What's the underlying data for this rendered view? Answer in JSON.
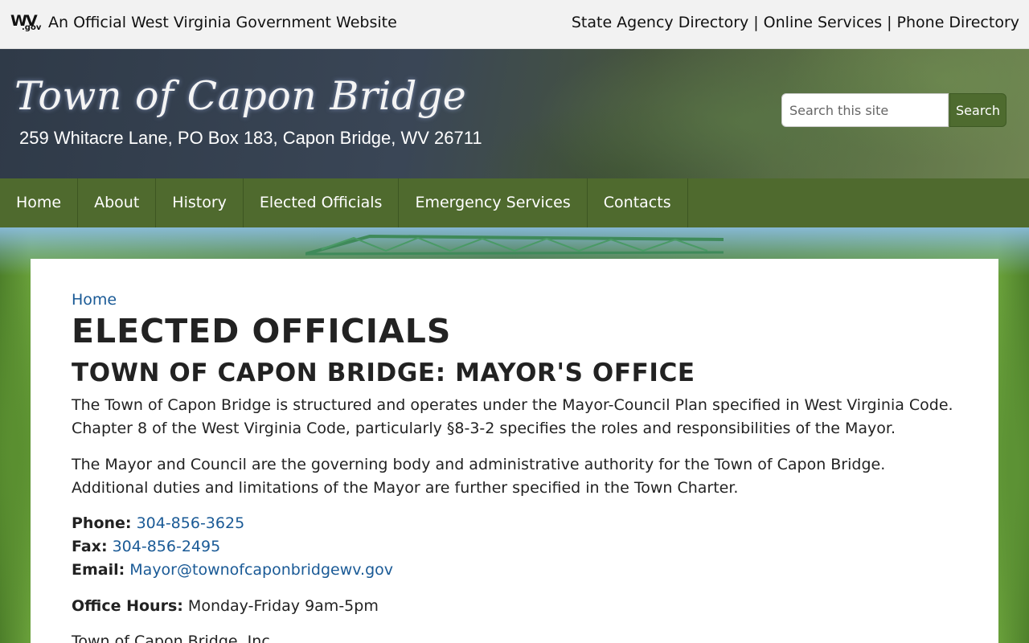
{
  "govbar": {
    "logo_wv": "WV",
    "logo_gov": ".gov",
    "official_text": "An Official West Virginia Government Website",
    "links": [
      "State Agency Directory",
      "Online Services",
      "Phone Directory"
    ],
    "separator": "|"
  },
  "header": {
    "title": "Town of Capon Bridge",
    "address": "259 Whitacre Lane, PO Box 183, Capon Bridge, WV 26711",
    "search_placeholder": "Search this site",
    "search_button": "Search"
  },
  "nav": {
    "items": [
      "Home",
      "About",
      "History",
      "Elected Officials",
      "Emergency Services",
      "Contacts"
    ]
  },
  "content": {
    "breadcrumb": "Home",
    "title": "ELECTED OFFICIALS",
    "subhead": "TOWN OF CAPON BRIDGE: MAYOR'S OFFICE",
    "para1": "The Town of Capon Bridge is structured and operates under the Mayor-Council Plan specified in West Virginia Code. Chapter 8 of the West Virginia Code, particularly §8-3-2 specifies the roles and responsibilities of the Mayor.",
    "para2": "The Mayor and Council are the governing body and administrative authority for the Town of Capon Bridge. Additional duties and limitations of the Mayor are further specified in the Town Charter.",
    "phone_label": "Phone:",
    "phone": "304-856-3625",
    "fax_label": "Fax:",
    "fax": "304-856-2495",
    "email_label": "Email:",
    "email": "Mayor@townofcaponbridgewv.gov",
    "hours_label": "Office Hours:",
    "hours": "Monday-Friday 9am-5pm",
    "footer_line": "Town of Capon Bridge, Inc."
  },
  "colors": {
    "nav_green": "#4f6a2e",
    "link_blue": "#1a5a96",
    "search_button": "#4e6b2f"
  }
}
